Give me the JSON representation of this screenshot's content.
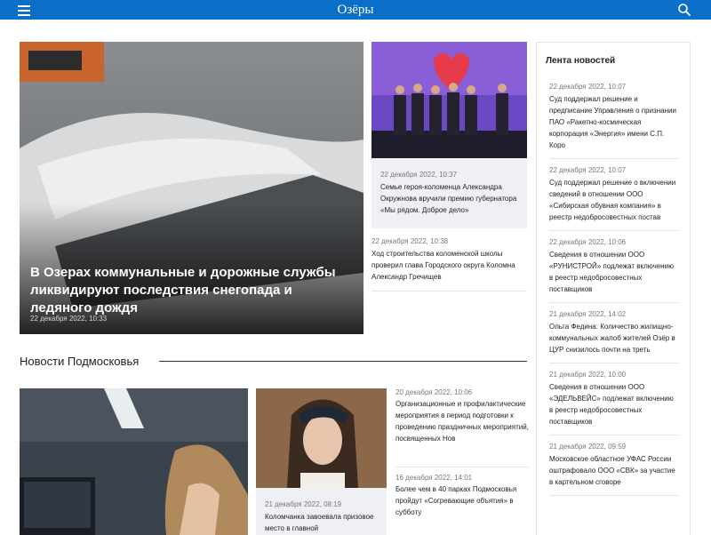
{
  "header": {
    "logo": "Озёры"
  },
  "hero": {
    "title": "В Озерах коммунальные и дорожные службы ликвидируют последствия снегопада и ледяного дождя",
    "date": "22 декабря 2022, 10:33"
  },
  "top_card": {
    "date": "22 декабря 2022, 10:37",
    "title": "Семье героя-коломенца Александра Окружнова вручили премию губернатора «Мы рядом. Доброе дело»"
  },
  "top_item": {
    "date": "22 декабря 2022, 10:38",
    "title": "Ход строительства коломенской школы проверил глава Городского округа Коломна Александр Гречищев"
  },
  "section": {
    "title": "Новости Подмосковья"
  },
  "bottom_card": {
    "date": "21 декабря 2022, 08:19",
    "title": "Коломчанка завоевала призовое место в главной"
  },
  "bottom_list": [
    {
      "date": "20 декабря 2022, 10:06",
      "title": "Организационные и профилактические мероприятия в период подготовки к проведению праздничных мероприятий, посвященных Нов"
    },
    {
      "date": "16 декабря 2022, 14:01",
      "title": "Более чем в 40 парках Подмосковья пройдут «Согревающие объятия» в субботу"
    }
  ],
  "feed": {
    "title": "Лента новостей",
    "items": [
      {
        "date": "22 декабря 2022, 10:07",
        "title": "Суд поддержал решение и предписание Управления о признании ПАО «Ракетно-космическая корпорация «Энергия» имени С.П. Коро"
      },
      {
        "date": "22 декабря 2022, 10:07",
        "title": "Суд поддержал решение о включении сведений в отношении ООО «Сибирская обувная компания» в реестр недобросовестных постав"
      },
      {
        "date": "22 декабря 2022, 10:06",
        "title": "Сведения в отношении ООО «РУНИСТРОЙ» подлежат включению в реестр недобросовестных поставщиков"
      },
      {
        "date": "21 декабря 2022, 14:02",
        "title": "Ольга Федина: Количество жилищно-коммунальных жалоб жителей Озёр в ЦУР снизилось почти на треть"
      },
      {
        "date": "21 декабря 2022, 10:00",
        "title": "Сведения в отношении ООО «ЭДЕЛЬВЕЙС» подлежат включению в реестр недобросовестных поставщиков"
      },
      {
        "date": "21 декабря 2022, 09:59",
        "title": "Московское областное УФАС России оштрафовало ООО «СВК» за участие в картельном сговоре"
      }
    ]
  },
  "colors": {
    "header_bg": "#0c6fc7",
    "card_bg": "#eef0f3"
  }
}
